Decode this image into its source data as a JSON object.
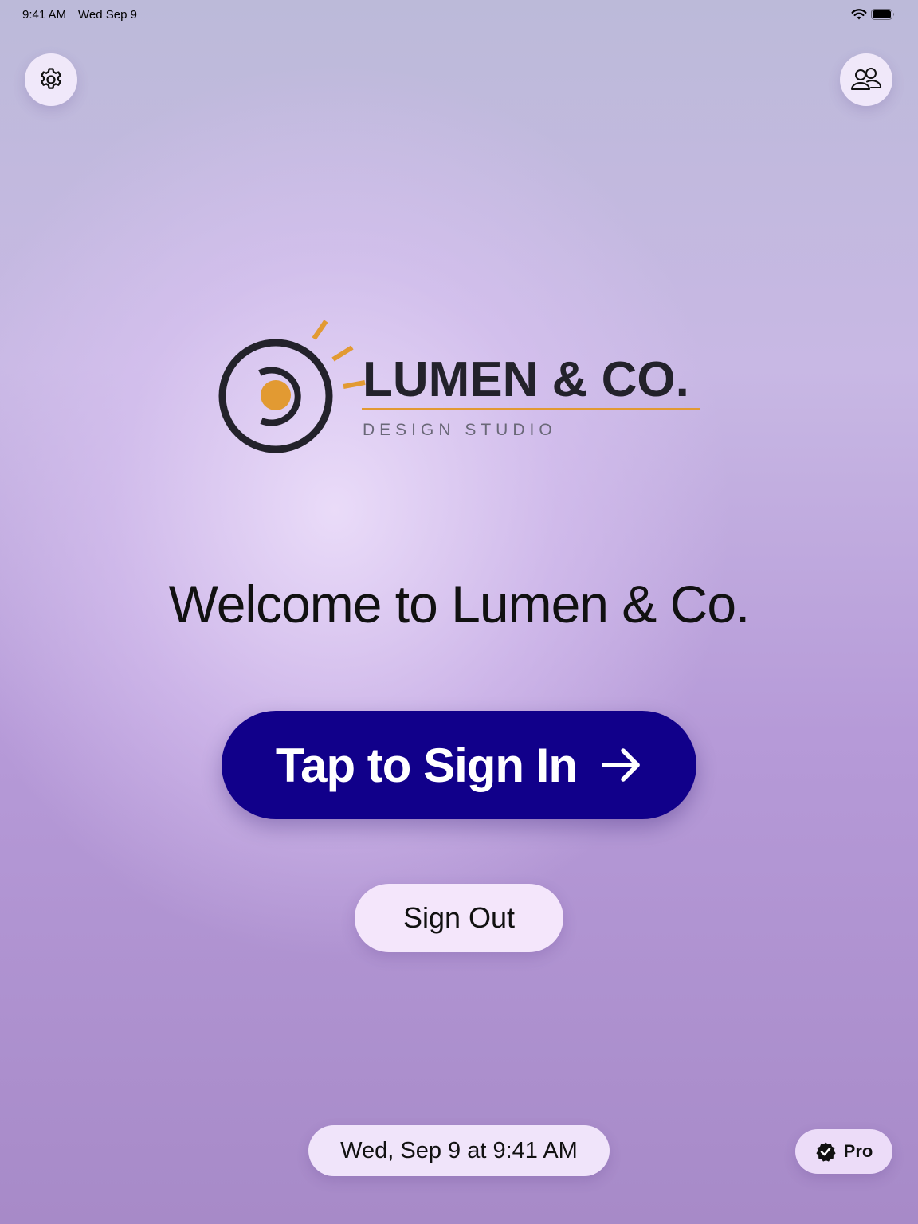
{
  "status_bar": {
    "time": "9:41 AM",
    "date": "Wed Sep 9",
    "icons": [
      "wifi-icon",
      "battery-icon"
    ]
  },
  "top_bar": {
    "left_icon": "gear-icon",
    "right_icon": "people-icon"
  },
  "logo": {
    "wordmark": "LUMEN & CO.",
    "tagline": "DESIGN STUDIO",
    "accent_color": "#e29a32",
    "ink_color": "#23222b"
  },
  "welcome": {
    "text": "Welcome to Lumen & Co."
  },
  "sign_in": {
    "label": "Tap to Sign In",
    "icon": "arrow-right-icon",
    "color": "#11008a"
  },
  "sign_out": {
    "label": "Sign Out"
  },
  "footer": {
    "datetime": "Wed, Sep 9 at 9:41 AM",
    "badge_label": "Pro",
    "badge_icon": "verified-check-icon"
  }
}
